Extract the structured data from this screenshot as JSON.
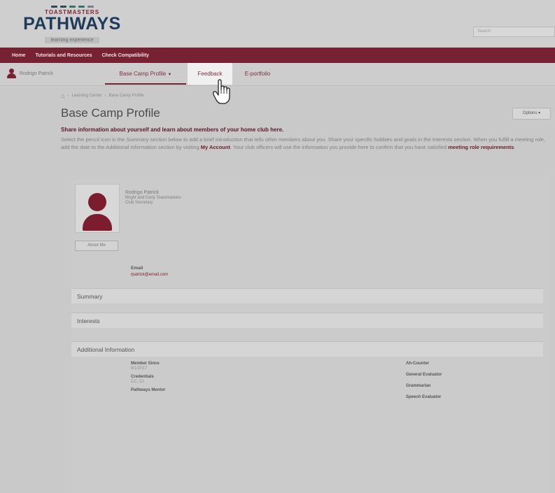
{
  "header": {
    "brand_top": "TOASTMASTERS",
    "brand": "PATHWAYS",
    "tagline": "learning experience",
    "search_placeholder": "Search"
  },
  "nav": {
    "items": [
      "Home",
      "Tutorials and Resources",
      "Check Compatibility"
    ]
  },
  "subnav": {
    "user_name": "Rodrigo Patrick",
    "tabs": [
      {
        "label": "Base Camp Profile",
        "caret": "▼"
      },
      {
        "label": "Feedback"
      },
      {
        "label": "E-portfolio"
      }
    ]
  },
  "breadcrumb": {
    "items": [
      "Home",
      "›",
      "Learning Center",
      "›",
      "Base Camp Profile"
    ]
  },
  "page": {
    "title": "Base Camp Profile",
    "options_label": "Options ▾",
    "intro_bold": "Share information about yourself and learn about members of your home club here.",
    "intro_text_1": "Select the pencil icon in the Summary section below to add a brief introduction that tells other members about you. Share your specific hobbies and goals in the Interests section. When you fulfill a meeting role, add the date to the Additional Information section by visiting ",
    "intro_link_1": "My Account",
    "intro_text_2": ". Your club officers will use the information you provide here to confirm that you have satisfied ",
    "intro_link_2": "meeting role requirements",
    "intro_text_3": "."
  },
  "profile": {
    "name": "Rodrigo Patrick",
    "club": "Bright and Early Toastmasters",
    "role": "Club Secretary",
    "about_button": "About Me",
    "email_label": "Email",
    "email_value": "rpatrick@email.com"
  },
  "sections": {
    "summary": "Summary",
    "interests": "Interests",
    "additional": "Additional Information"
  },
  "additional_info": {
    "left": [
      {
        "label": "Member Since",
        "value": "6/1/2017"
      },
      {
        "label": "Credentials",
        "value": "CC, CL"
      },
      {
        "label": "Pathways Mentor",
        "value": ""
      }
    ],
    "right": [
      "Ah-Counter",
      "General Evaluator",
      "Grammarian",
      "Speech Evaluator"
    ]
  },
  "colors": {
    "brand_maroon": "#772232",
    "brand_navy": "#1f3b5a"
  }
}
